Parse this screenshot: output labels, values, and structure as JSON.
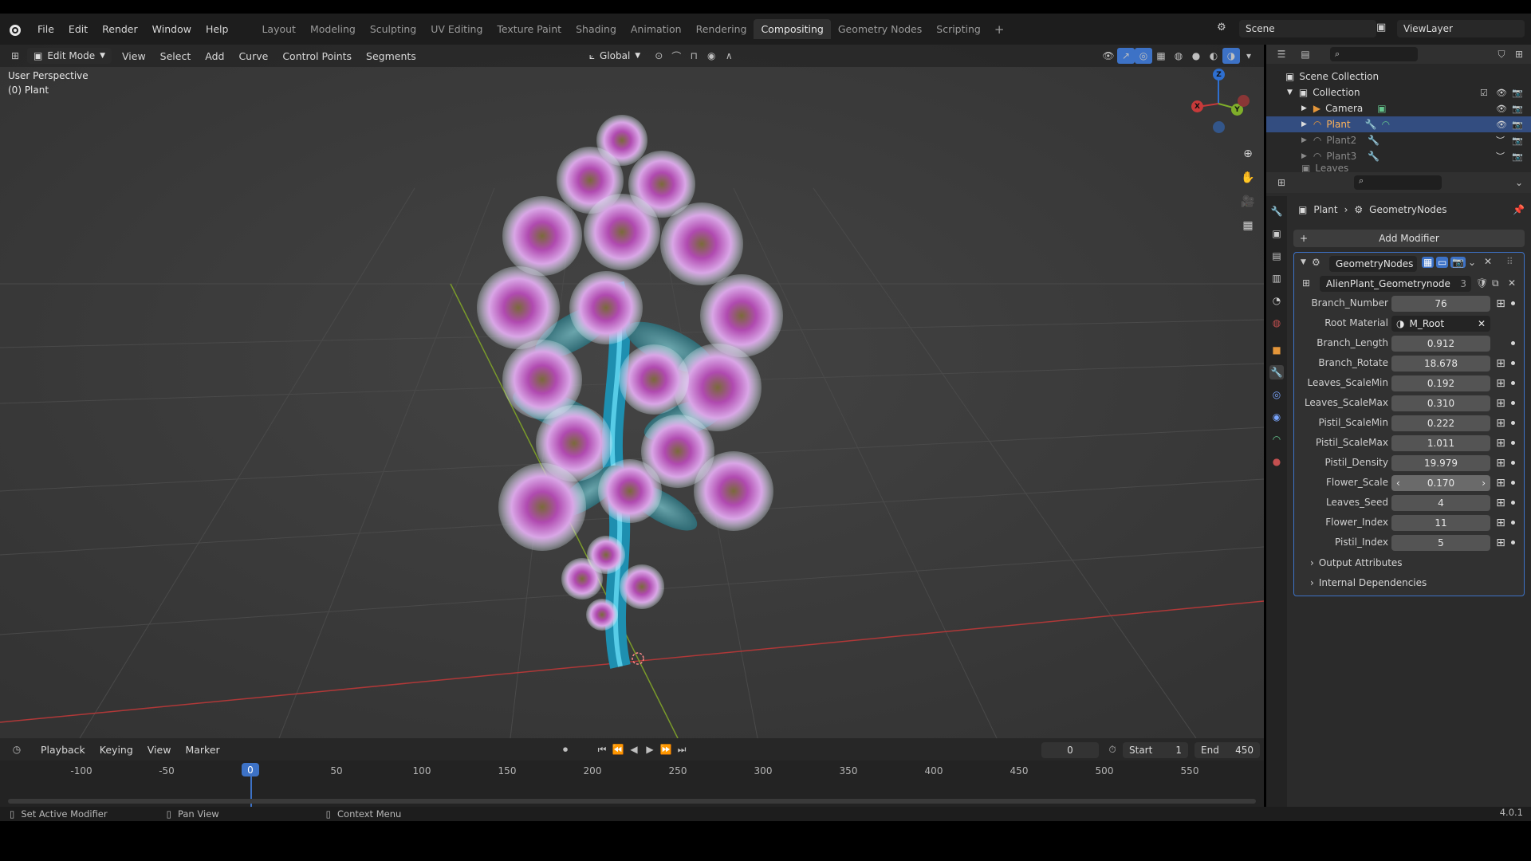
{
  "topbar": {
    "menus": [
      "File",
      "Edit",
      "Render",
      "Window",
      "Help"
    ],
    "workspaces": [
      "Layout",
      "Modeling",
      "Sculpting",
      "UV Editing",
      "Texture Paint",
      "Shading",
      "Animation",
      "Rendering",
      "Compositing",
      "Geometry Nodes",
      "Scripting"
    ],
    "active_workspace": "Compositing",
    "plus": "+",
    "scene": "Scene",
    "view_layer": "ViewLayer"
  },
  "viewport": {
    "mode": "Edit Mode",
    "menus": [
      "View",
      "Select",
      "Add",
      "Curve",
      "Control Points",
      "Segments"
    ],
    "transform": "Global",
    "perspective_label": "User Perspective",
    "object_label": "(0) Plant",
    "gizmo": {
      "x": "X",
      "y": "Y",
      "z": "Z"
    }
  },
  "timeline": {
    "menus": [
      "Playback",
      "Keying",
      "View",
      "Marker"
    ],
    "current_frame": "0",
    "start_label": "Start",
    "start": "1",
    "end_label": "End",
    "end": "450",
    "ticks": [
      "-100",
      "-50",
      "0",
      "50",
      "100",
      "150",
      "200",
      "250",
      "300",
      "350",
      "400",
      "450",
      "500",
      "550"
    ]
  },
  "statusbar": {
    "hint1": "Set Active Modifier",
    "hint2": "Pan View",
    "hint3": "Context Menu",
    "version": "4.0.1"
  },
  "outliner": {
    "scene_collection": "Scene Collection",
    "collection": "Collection",
    "items": [
      "Camera",
      "Plant",
      "Plant2",
      "Plant3"
    ],
    "leaves": "Leaves"
  },
  "properties": {
    "breadcrumb_object": "Plant",
    "breadcrumb_modifier": "GeometryNodes",
    "add_modifier": "Add Modifier",
    "modifier_name": "GeometryNodes",
    "node_tree": "AlienPlant_Geometrynode",
    "node_tree_users": "3",
    "params": [
      {
        "label": "Branch_Number",
        "value": "76"
      },
      {
        "label": "Root Material",
        "value": "M_Root"
      },
      {
        "label": "Branch_Length",
        "value": "0.912"
      },
      {
        "label": "Branch_Rotate",
        "value": "18.678"
      },
      {
        "label": "Leaves_ScaleMin",
        "value": "0.192"
      },
      {
        "label": "Leaves_ScaleMax",
        "value": "0.310"
      },
      {
        "label": "Pistil_ScaleMin",
        "value": "0.222"
      },
      {
        "label": "Pistil_ScaleMax",
        "value": "1.011"
      },
      {
        "label": "Pistil_Density",
        "value": "19.979"
      },
      {
        "label": "Flower_Scale",
        "value": "0.170"
      },
      {
        "label": "Leaves_Seed",
        "value": "4"
      },
      {
        "label": "Flower_Index",
        "value": "11"
      },
      {
        "label": "Pistil_Index",
        "value": "5"
      }
    ],
    "output_attributes": "Output Attributes",
    "internal_dependencies": "Internal Dependencies"
  },
  "colors": {
    "accent": "#3d72c6",
    "selected_row": "#334d80",
    "axis_x": "#c73a3a",
    "axis_y": "#7fae2a",
    "axis_z": "#2e6fd0"
  }
}
